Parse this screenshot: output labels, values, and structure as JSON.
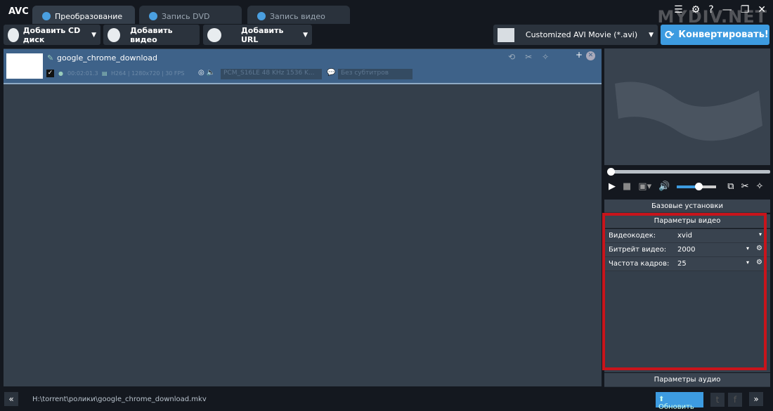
{
  "app": {
    "logo": "AVC",
    "watermark": "MYDIV.NET"
  },
  "tabs": [
    {
      "label": "Преобразование"
    },
    {
      "label": "Запись DVD"
    },
    {
      "label": "Запись видео"
    }
  ],
  "toolbar": {
    "add_cd": "Добавить CD диск",
    "add_video": "Добавить видео",
    "add_url": "Добавить URL",
    "format": "Customized AVI Movie (*.avi)",
    "convert": "Конвертировать!"
  },
  "file": {
    "name": "google_chrome_download",
    "duration": "00:02:01.3",
    "video_info": "H264 | 1280x720 | 30 FPS",
    "audio": "PCM_S16LE 48 KHz 1536 K...",
    "subtitles": "Без субтитров"
  },
  "settings": {
    "basic": "Базовые установки",
    "video_params": "Параметры видео",
    "rows": [
      {
        "label": "Видеокодек:",
        "value": "xvid"
      },
      {
        "label": "Битрейт видео:",
        "value": "2000"
      },
      {
        "label": "Частота кадров:",
        "value": "25"
      }
    ],
    "audio_params": "Параметры аудио"
  },
  "player": {
    "volume": 0.55,
    "position": 0
  },
  "status": {
    "path": "H:\\torrent\\ролики\\google_chrome_download.mkv",
    "update": "Обновить"
  }
}
